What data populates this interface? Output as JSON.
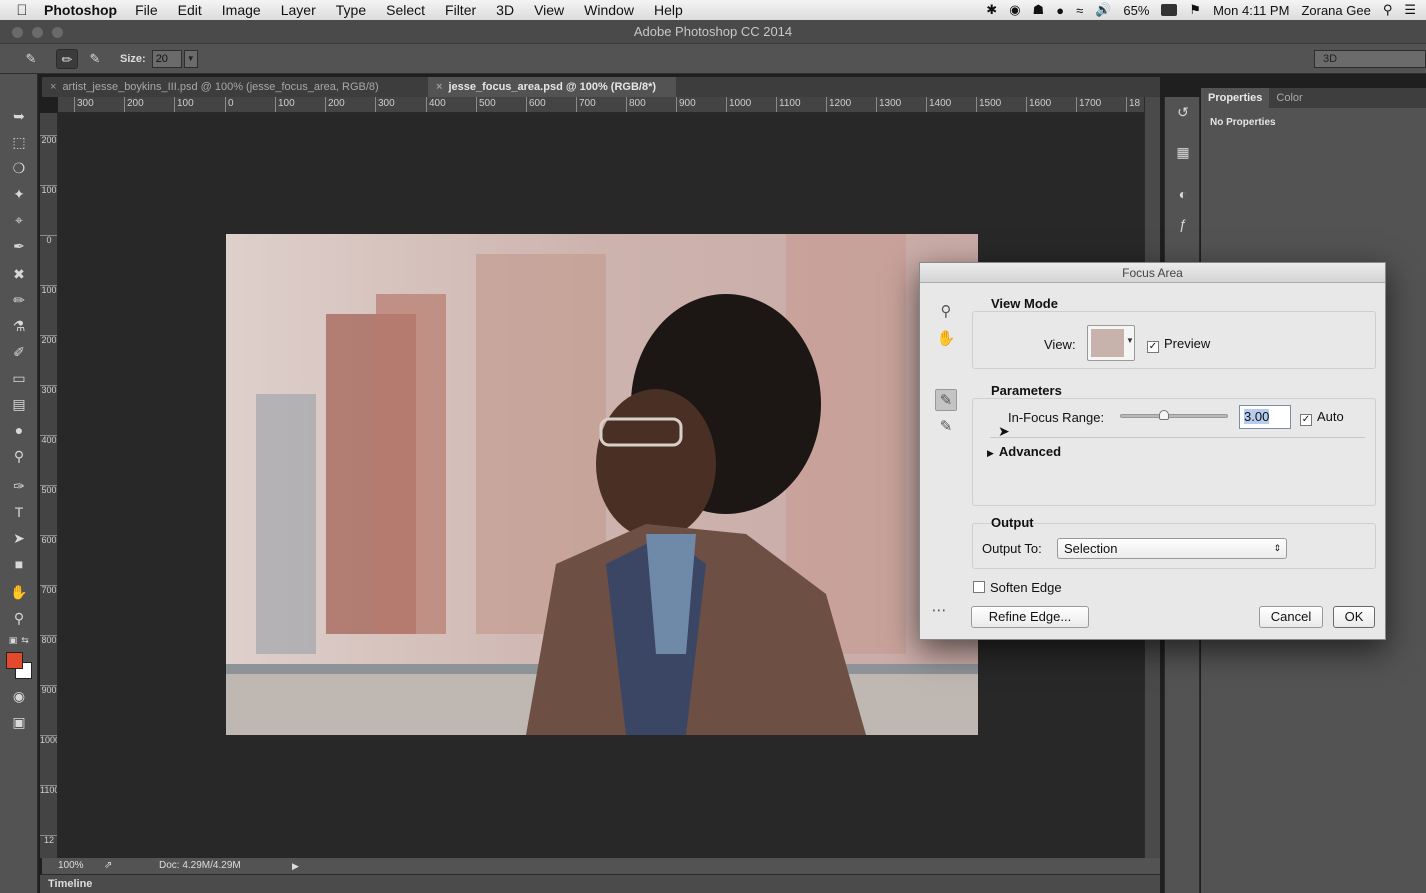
{
  "menubar": {
    "app_name": "Photoshop",
    "items": [
      "File",
      "Edit",
      "Image",
      "Layer",
      "Type",
      "Select",
      "Filter",
      "3D",
      "View",
      "Window",
      "Help"
    ],
    "battery": "65%",
    "clock": "Mon 4:11 PM",
    "user": "Zorana Gee"
  },
  "window": {
    "title": "Adobe Photoshop CC 2014"
  },
  "options": {
    "size_label": "Size:",
    "size_value": "20",
    "workspace": "3D"
  },
  "tabs": [
    {
      "label": "artist_jesse_boykins_III.psd @ 100% (jesse_focus_area, RGB/8)"
    },
    {
      "label": "jesse_focus_area.psd @ 100% (RGB/8*)"
    }
  ],
  "ruler": {
    "h_labels": [
      "300",
      "200",
      "100",
      "0",
      "100",
      "200",
      "300",
      "400",
      "500",
      "600",
      "700",
      "800",
      "900",
      "1000",
      "1100",
      "1200",
      "1300",
      "1400",
      "1500",
      "1600",
      "1700",
      "18"
    ],
    "v_labels": [
      "200",
      "100",
      "0",
      "100",
      "200",
      "300",
      "400",
      "500",
      "600",
      "700",
      "800",
      "900",
      "1000",
      "1100",
      "12"
    ]
  },
  "status": {
    "zoom": "100%",
    "doc": "Doc: 4.29M/4.29M"
  },
  "timeline": {
    "label": "Timeline"
  },
  "panel": {
    "tab_properties": "Properties",
    "tab_color": "Color",
    "no_properties": "No Properties"
  },
  "dialog": {
    "title": "Focus Area",
    "view_mode": {
      "title": "View Mode",
      "view_label": "View:",
      "preview_label": "Preview",
      "preview_checked": true
    },
    "parameters": {
      "title": "Parameters",
      "range_label": "In-Focus Range:",
      "range_value": "3.00",
      "range_slider": 0.4,
      "auto_label": "Auto",
      "auto_checked": true,
      "advanced_label": "Advanced"
    },
    "output": {
      "title": "Output",
      "output_to_label": "Output To:",
      "output_to_value": "Selection"
    },
    "soften_edge_label": "Soften Edge",
    "soften_edge_checked": false,
    "refine_edge_button": "Refine Edge...",
    "cancel_button": "Cancel",
    "ok_button": "OK"
  }
}
